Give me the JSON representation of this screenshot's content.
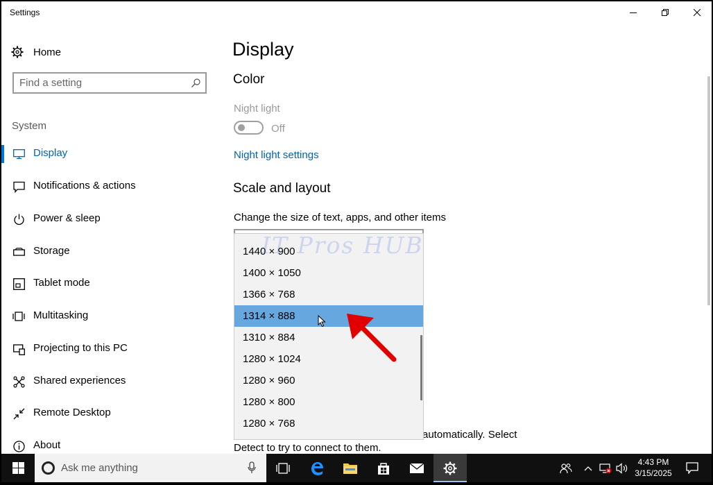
{
  "window": {
    "title": "Settings"
  },
  "nav": {
    "home_label": "Home",
    "search_placeholder": "Find a setting",
    "section_label": "System",
    "items": [
      {
        "label": "Display",
        "icon": "monitor-icon",
        "active": true
      },
      {
        "label": "Notifications & actions",
        "icon": "notification-icon"
      },
      {
        "label": "Power & sleep",
        "icon": "power-icon"
      },
      {
        "label": "Storage",
        "icon": "storage-icon"
      },
      {
        "label": "Tablet mode",
        "icon": "tablet-icon"
      },
      {
        "label": "Multitasking",
        "icon": "multitasking-icon"
      },
      {
        "label": "Projecting to this PC",
        "icon": "projector-icon"
      },
      {
        "label": "Shared experiences",
        "icon": "shared-icon"
      },
      {
        "label": "Remote Desktop",
        "icon": "remote-desktop-icon"
      },
      {
        "label": "About",
        "icon": "info-icon"
      }
    ]
  },
  "main": {
    "page_title": "Display",
    "color_heading": "Color",
    "night_light_label": "Night light",
    "night_light_state": "Off",
    "night_light_link": "Night light settings",
    "scale_heading": "Scale and layout",
    "scale_desc": "Change the size of text, apps, and other items",
    "bottom_text_1": "automatically. Select",
    "bottom_text_2": "Detect to try to connect to them."
  },
  "watermark": "IT Pros HUB",
  "resolution_dropdown": {
    "selected": "1314 × 888",
    "options": [
      "1440 × 900",
      "1400 × 1050",
      "1366 × 768",
      "1314 × 888",
      "1310 × 884",
      "1280 × 1024",
      "1280 × 960",
      "1280 × 800",
      "1280 × 768"
    ]
  },
  "taskbar": {
    "search_text": "Ask me anything",
    "time": "4:43 PM",
    "date": "3/15/2025"
  },
  "colors": {
    "accent": "#0078d7",
    "link": "#0063b1",
    "selection": "#66a7e0",
    "taskbar": "#101010"
  }
}
